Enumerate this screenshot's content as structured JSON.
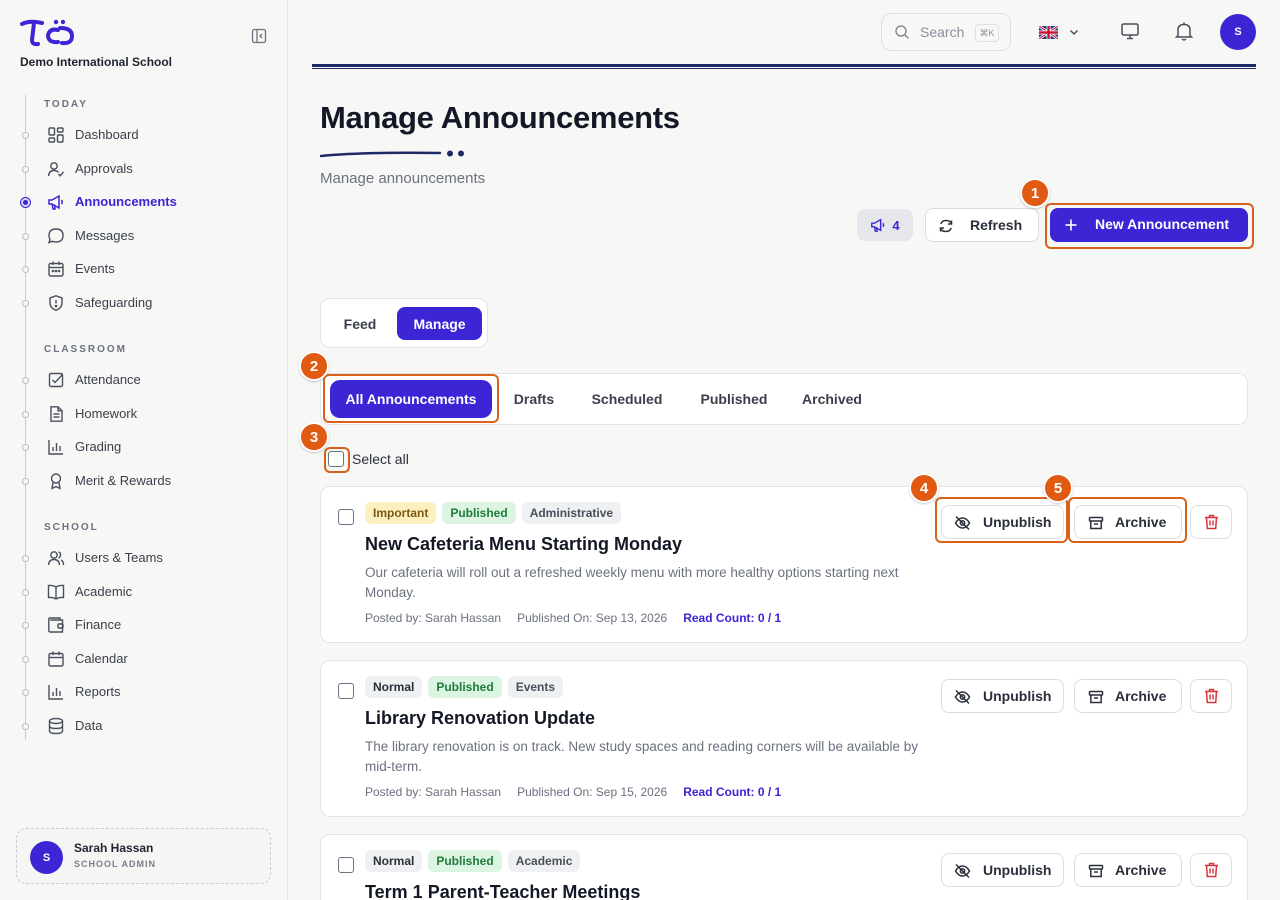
{
  "sidebar": {
    "school_name": "Demo International School",
    "sections": [
      "TODAY",
      "CLASSROOM",
      "SCHOOL"
    ],
    "today": [
      {
        "label": "Dashboard",
        "icon": "dashboard-icon"
      },
      {
        "label": "Approvals",
        "icon": "user-check-icon"
      },
      {
        "label": "Announcements",
        "icon": "megaphone-icon",
        "active": true
      },
      {
        "label": "Messages",
        "icon": "chat-bubble-icon"
      },
      {
        "label": "Events",
        "icon": "calendar-icon"
      },
      {
        "label": "Safeguarding",
        "icon": "shield-icon"
      }
    ],
    "classroom": [
      {
        "label": "Attendance",
        "icon": "checkbox-icon"
      },
      {
        "label": "Homework",
        "icon": "document-icon"
      },
      {
        "label": "Grading",
        "icon": "bar-chart-icon"
      },
      {
        "label": "Merit & Rewards",
        "icon": "award-icon"
      }
    ],
    "school": [
      {
        "label": "Users & Teams",
        "icon": "users-icon"
      },
      {
        "label": "Academic",
        "icon": "book-icon"
      },
      {
        "label": "Finance",
        "icon": "wallet-icon"
      },
      {
        "label": "Calendar",
        "icon": "calendar-icon"
      },
      {
        "label": "Reports",
        "icon": "bar-chart-icon"
      },
      {
        "label": "Data",
        "icon": "database-icon"
      }
    ],
    "user": {
      "initial": "S",
      "name": "Sarah Hassan",
      "role": "SCHOOL ADMIN"
    }
  },
  "topbar": {
    "search_placeholder": "Search",
    "search_shortcut": "⌘K",
    "avatar_initial": "S"
  },
  "header": {
    "title": "Manage Announcements",
    "subtitle": "Manage announcements",
    "count": "4",
    "refresh_label": "Refresh",
    "new_label": "New Announcement"
  },
  "view_toggle": {
    "feed": "Feed",
    "manage": "Manage"
  },
  "filters": [
    "All Announcements",
    "Drafts",
    "Scheduled",
    "Published",
    "Archived"
  ],
  "select_all_label": "Select all",
  "actions": {
    "unpublish": "Unpublish",
    "archive": "Archive"
  },
  "annotations": [
    "1",
    "2",
    "3",
    "4",
    "5"
  ],
  "announcements": [
    {
      "priority": "Important",
      "status": "Published",
      "category": "Administrative",
      "title": "New Cafeteria Menu Starting Monday",
      "body": "Our cafeteria will roll out a refreshed weekly menu with more healthy options starting next Monday.",
      "posted_by": "Posted by: Sarah Hassan",
      "published_on": "Published On: Sep 13, 2026",
      "read_count": "Read Count: 0 / 1"
    },
    {
      "priority": "Normal",
      "status": "Published",
      "category": "Events",
      "title": "Library Renovation Update",
      "body": "The library renovation is on track. New study spaces and reading corners will be available by mid-term.",
      "posted_by": "Posted by: Sarah Hassan",
      "published_on": "Published On: Sep 15, 2026",
      "read_count": "Read Count: 0 / 1"
    },
    {
      "priority": "Normal",
      "status": "Published",
      "category": "Academic",
      "title": "Term 1 Parent-Teacher Meetings"
    }
  ],
  "colors": {
    "accent": "#3b25d4",
    "annotation": "#e05a12",
    "navy_rule": "#1e2a66"
  }
}
